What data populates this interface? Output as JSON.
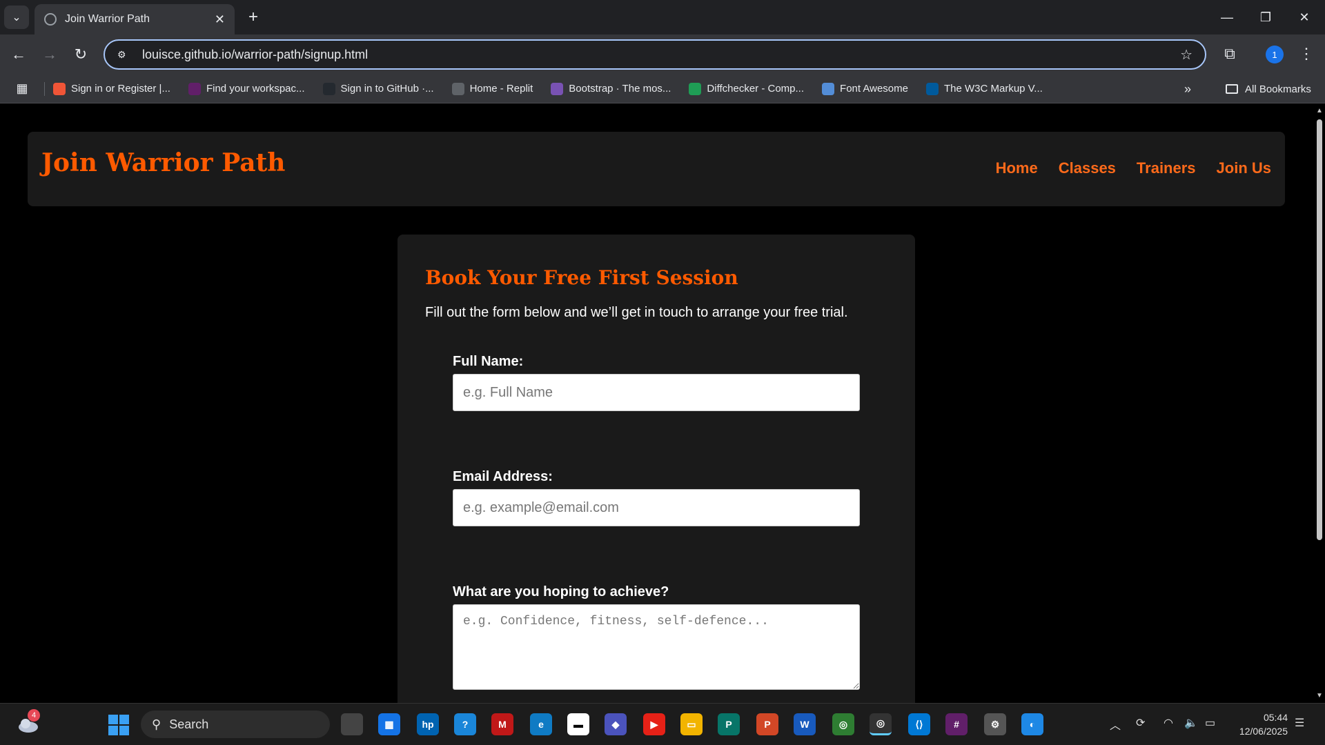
{
  "browser": {
    "tab_title": "Join Warrior Path",
    "url": "louisce.github.io/warrior-path/signup.html",
    "profile_initial": "1",
    "bookmarks": [
      {
        "label": "Sign in or Register |...",
        "icon": "eventbrite-icon",
        "color": "#f05537"
      },
      {
        "label": "Find your workspac...",
        "icon": "slack-icon",
        "color": "#611f69"
      },
      {
        "label": "Sign in to GitHub ·...",
        "icon": "github-icon",
        "color": "#24292f"
      },
      {
        "label": "Home - Replit",
        "icon": "replit-icon",
        "color": "#5f6368"
      },
      {
        "label": "Bootstrap · The mos...",
        "icon": "bootstrap-icon",
        "color": "#7952b3"
      },
      {
        "label": "Diffchecker - Comp...",
        "icon": "diffchecker-icon",
        "color": "#1f9d55"
      },
      {
        "label": "Font Awesome",
        "icon": "font-awesome-icon",
        "color": "#538dd7"
      },
      {
        "label": "The W3C Markup V...",
        "icon": "w3c-icon",
        "color": "#005a9c"
      }
    ],
    "all_bookmarks_label": "All Bookmarks"
  },
  "site": {
    "logo": "Join Warrior Path",
    "nav": [
      "Home",
      "Classes",
      "Trainers",
      "Join Us"
    ],
    "accent_color": "#ff5a00"
  },
  "form": {
    "title": "Book Your Free First Session",
    "intro": "Fill out the form below and we’ll get in touch to arrange your free trial.",
    "name_label": "Full Name:",
    "name_placeholder": "e.g. Full Name",
    "email_label": "Email Address:",
    "email_placeholder": "e.g. example@email.com",
    "goal_label": "What are you hoping to achieve?",
    "goal_placeholder": "e.g. Confidence, fitness, self-defence..."
  },
  "taskbar": {
    "search_label": "Search",
    "weather_badge": "4",
    "time": "05:44",
    "date": "12/06/2025"
  }
}
